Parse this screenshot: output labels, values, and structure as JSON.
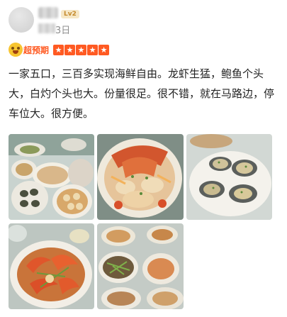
{
  "user": {
    "level_badge": "Lv2",
    "date_tail": "3日"
  },
  "rating": {
    "label": "超预期",
    "stars": 5,
    "star_glyph": "★"
  },
  "review": {
    "text": "一家五口，三百多实现海鲜自由。龙虾生猛，鲍鱼个头大，白灼个头也大。份量很足。很不错，就在马路边，停车位大。很方便。"
  },
  "colors": {
    "accent": "#ff5a22",
    "badge_bg": "#f6e7c6",
    "badge_text": "#c58a2c",
    "date_text": "#8d8d8d"
  },
  "photos": [
    {
      "name": "photo-1",
      "subject": "table-of-seafood-dishes"
    },
    {
      "name": "photo-2",
      "subject": "lobster-with-noodles"
    },
    {
      "name": "photo-3",
      "subject": "steamed-abalone"
    },
    {
      "name": "photo-4",
      "subject": "stir-fried-shrimp"
    },
    {
      "name": "photo-5",
      "subject": "table-with-scallion-dishes"
    }
  ]
}
